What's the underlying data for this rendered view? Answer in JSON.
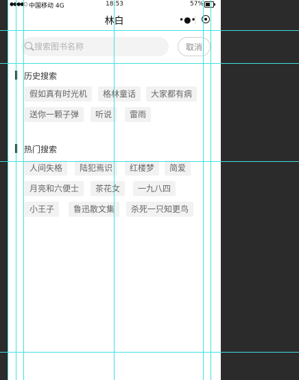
{
  "statusbar": {
    "signal": "●●●●○",
    "carrier": "中国移动 4G",
    "time": "18:53",
    "battery": "57%"
  },
  "navbar": {
    "title": "林白",
    "more": "•●•"
  },
  "search": {
    "placeholder": "搜索图书名称",
    "cancel_label": "取消"
  },
  "history": {
    "title": "历史搜索",
    "tags": [
      "假如真有时光机",
      "格林童话",
      "大家都有病",
      "送你一颗子弹",
      "听说",
      "雷雨"
    ]
  },
  "hot": {
    "title": "热门搜索",
    "tags": [
      "人间失格",
      "陆犯焉识",
      "红楼梦",
      "简爱",
      "月亮和六便士",
      "茶花女",
      "一九八四",
      "小王子",
      "鲁迅散文集",
      "杀死一只知更鸟"
    ]
  },
  "colors": {
    "guide": "#3fe0e0",
    "background": "#2b2b2b",
    "tag_bg": "#f2f2f2"
  }
}
